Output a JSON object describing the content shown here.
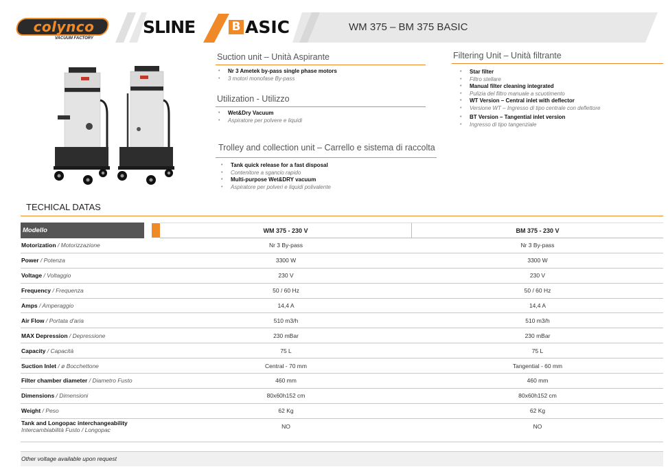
{
  "header": {
    "logo_text": "colynco",
    "logo_sub": "VACUUM FACTORY",
    "series_line": "SLINE",
    "series_b": "B",
    "series_basic_rest": "ASIC",
    "title": "WM 375 – BM 375 BASIC",
    "accent_color": "#f08a28"
  },
  "sections": {
    "suction": {
      "title": "Suction unit – Unità Aspirante",
      "items": [
        {
          "en": "Nr 3 Ametek by-pass single phase motors",
          "it": "3 motori monofase By-pass"
        }
      ]
    },
    "utilization": {
      "title": "Utilization - Utilizzo",
      "items": [
        {
          "en": "Wet&Dry Vacuum",
          "it": "Aspiratore per polvere e liquidi"
        }
      ]
    },
    "trolley": {
      "title": "Trolley and collection unit – Carrello e sistema di raccolta",
      "items": [
        {
          "en": "Tank quick release for a fast disposal",
          "it": "Contenitore a sgancio rapido"
        },
        {
          "en": "Multi-purpose Wet&DRY vacuum",
          "it": "Aspiratore per polveri e liquidi polivalente"
        }
      ]
    },
    "filtering": {
      "title": "Filtering Unit – Unità filtrante",
      "items": [
        {
          "en": "Star filter",
          "it": "Filtro stellare"
        },
        {
          "en": "Manual filter cleaning integrated",
          "it": "Pulizia del filtro manuale a scuotimento"
        },
        {
          "en": "WT Version – Central inlet with deflector",
          "it": "Versione WT – Ingresso di tipo centrale con deflettore"
        },
        {
          "en": "BT Version – Tangential inlet version",
          "it": "Ingresso di tipo tangenziale"
        }
      ]
    }
  },
  "tech": {
    "title": "TECHICAL DATAS",
    "header": {
      "label": "Modello",
      "col1": "WM 375 - 230 V",
      "col2": "BM 375 - 230 V"
    },
    "rows": [
      {
        "en": "Motorization",
        "sep": " / ",
        "it": "Motorizzazione",
        "v1": "Nr 3 By-pass",
        "v2": "Nr 3 By-pass"
      },
      {
        "en": "Power",
        "sep": " / ",
        "it": "Potenza",
        "v1": "3300 W",
        "v2": "3300 W"
      },
      {
        "en": "Voltage",
        "sep": " / ",
        "it": "Voltaggio",
        "v1": "230 V",
        "v2": "230 V"
      },
      {
        "en": "Frequency",
        "sep": " / ",
        "it": "Frequenza",
        "v1": "50 / 60 Hz",
        "v2": "50 / 60 Hz"
      },
      {
        "en": "Amps",
        "sep": " / ",
        "it": "Amperaggio",
        "v1": "14,4 A",
        "v2": "14,4 A"
      },
      {
        "en": "Air Flow",
        "sep": " / ",
        "it": "Portata d'aria",
        "v1": "510 m3/h",
        "v2": "510 m3/h"
      },
      {
        "en": "MAX Depression",
        "sep": " / ",
        "it": "Depressione",
        "v1": "230 mBar",
        "v2": "230 mBar"
      },
      {
        "en": "Capacity",
        "sep": " / ",
        "it": "Capacità",
        "v1": "75 L",
        "v2": "75 L"
      },
      {
        "en": "Suction Inlet",
        "sep": " / ",
        "it": "ø Bocchettone",
        "v1": "Central - 70 mm",
        "v2": "Tangential - 60 mm"
      },
      {
        "en": "Filter chamber diameter",
        "sep": " / ",
        "it": "Diametro Fusto",
        "v1": "460 mm",
        "v2": "460 mm"
      },
      {
        "en": "Dimensions",
        "sep": " / ",
        "it": "Dimensioni",
        "v1": "80x60h152 cm",
        "v2": "80x60h152 cm"
      },
      {
        "en": "Weight",
        "sep": " / ",
        "it": "Peso",
        "v1": "62 Kg",
        "v2": "62 Kg"
      }
    ],
    "last_row": {
      "en": "Tank and Longopac interchangeability",
      "it": "Intercambiabilità Fusto / Longopac",
      "v1": "NO",
      "v2": "NO"
    },
    "footer": "Other voltage available upon request"
  }
}
